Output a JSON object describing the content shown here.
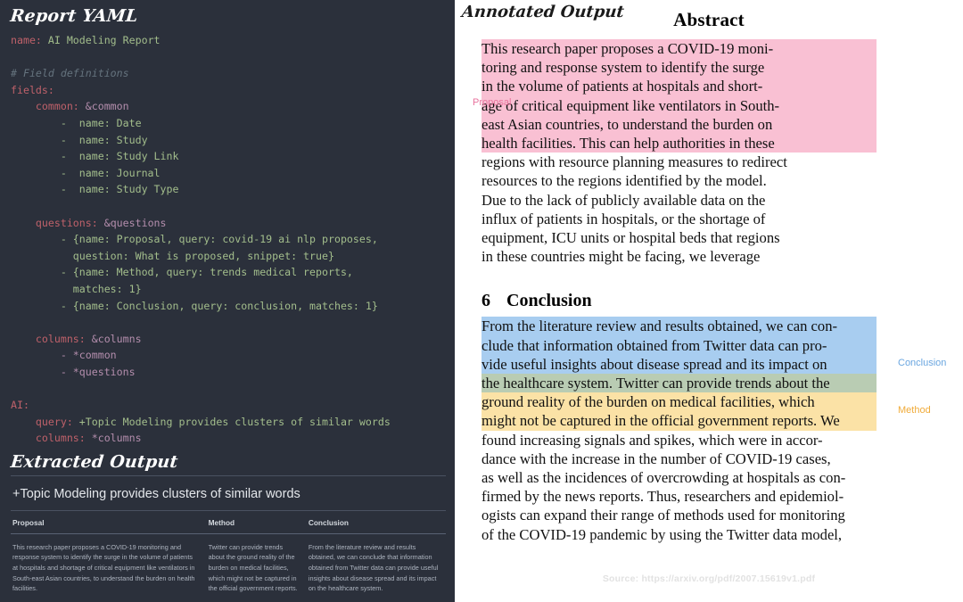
{
  "left": {
    "title": "Report YAML",
    "extracted_title": "Extracted Output",
    "yaml": {
      "l1_key": "name:",
      "l1_val": " AI Modeling Report",
      "comment": "# Field definitions",
      "fields_key": "fields:",
      "common_key": "    common:",
      "common_anchor": " &common",
      "items_common": [
        "        -  name: Date",
        "        -  name: Study",
        "        -  name: Study Link",
        "        -  name: Journal",
        "        -  name: Study Type"
      ],
      "questions_key": "    questions:",
      "questions_anchor": " &questions",
      "q1_a": "        - {name: Proposal, query: covid-19 ai nlp proposes,",
      "q1_b": "          question: What is proposed, snippet: true}",
      "q2_a": "        - {name: Method, query: trends medical reports,",
      "q2_b": "          matches: 1}",
      "q3": "        - {name: Conclusion, query: conclusion, matches: 1}",
      "columns_key": "    columns:",
      "columns_anchor": " &columns",
      "col_common": "        - *common",
      "col_questions": "        - *questions",
      "ai_key": "AI:",
      "ai_query_key": "    query:",
      "ai_query_val": " +Topic Modeling provides clusters of similar words",
      "ai_columns_key": "    columns:",
      "ai_columns_val": " *columns"
    },
    "query_heading": "+Topic Modeling provides clusters of similar words",
    "table": {
      "headers": [
        "Proposal",
        "Method",
        "Conclusion"
      ],
      "row": [
        "This research paper proposes a COVID-19 monitoring and response system to identify the surge in the volume of patients at hospitals and shortage of critical equipment like ventilators in South-east Asian countries, to understand the burden on health facilities.",
        "Twitter can provide trends about the ground reality of the burden on medical facilities, which might not be captured in the official government reports.",
        "From the literature review and results obtained, we can conclude that information obtained from Twitter data can provide useful insights about disease spread and its impact on the healthcare system."
      ]
    }
  },
  "right": {
    "title": "Annotated Output",
    "abstract_heading": "Abstract",
    "conclusion_number": "6",
    "conclusion_heading": "Conclusion",
    "tags": {
      "proposal": "Proposal",
      "conclusion": "Conclusion",
      "method": "Method"
    },
    "abstract_lines_highlighted": [
      "This research paper proposes a COVID-19 moni-",
      "toring and response system to identify the surge",
      "in the volume of patients at hospitals and short-",
      "age of critical equipment like ventilators in South-",
      "east Asian countries, to understand the burden on",
      "health facilities.  This can help authorities in these"
    ],
    "abstract_lines_plain": [
      "regions with resource planning measures to redirect",
      "resources to the regions identified by the model.",
      "Due to the lack of publicly available data on the",
      "influx of patients in hospitals, or the shortage of",
      "equipment, ICU units or hospital beds that regions",
      "in these countries might be facing, we leverage"
    ],
    "conclusion_lines_blue": [
      "From the literature review and results obtained, we can con-",
      "clude that information obtained from Twitter data can pro-",
      "vide useful insights about disease spread and its impact on"
    ],
    "conclusion_line_both": "the healthcare system.  Twitter can provide trends about the",
    "conclusion_lines_yellow": [
      "ground reality of the burden on medical facilities, which",
      "might not be captured in the official government reports. We"
    ],
    "conclusion_lines_plain": [
      "found increasing signals and spikes, which were in accor-",
      "dance with the increase in the number of COVID-19 cases,",
      "as well as the incidences of overcrowding at hospitals as con-",
      "firmed by the news reports. Thus, researchers and epidemiol-",
      "ogists can expand their range of methods used for monitoring",
      "of the COVID-19 pandemic by using the Twitter data model,"
    ],
    "source": "Source: https://arxiv.org/pdf/2007.15619v1.pdf"
  },
  "colors": {
    "panel_bg": "#2b303b",
    "highlight_proposal": "#f9c0d3",
    "highlight_conclusion": "#a8cdf0",
    "highlight_method": "#fbe2a6",
    "highlight_overlap": "#b9ccb3"
  }
}
